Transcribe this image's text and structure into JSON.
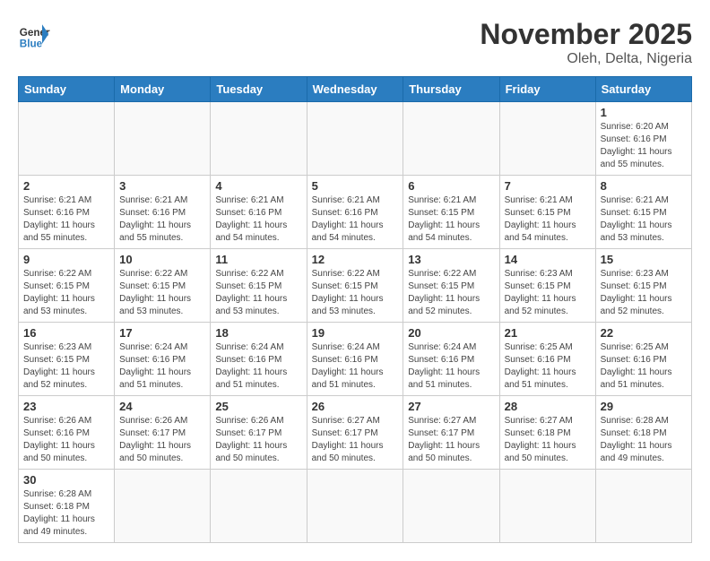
{
  "header": {
    "logo_general": "General",
    "logo_blue": "Blue",
    "month_year": "November 2025",
    "location": "Oleh, Delta, Nigeria"
  },
  "weekdays": [
    "Sunday",
    "Monday",
    "Tuesday",
    "Wednesday",
    "Thursday",
    "Friday",
    "Saturday"
  ],
  "weeks": [
    [
      {
        "day": "",
        "info": ""
      },
      {
        "day": "",
        "info": ""
      },
      {
        "day": "",
        "info": ""
      },
      {
        "day": "",
        "info": ""
      },
      {
        "day": "",
        "info": ""
      },
      {
        "day": "",
        "info": ""
      },
      {
        "day": "1",
        "info": "Sunrise: 6:20 AM\nSunset: 6:16 PM\nDaylight: 11 hours\nand 55 minutes."
      }
    ],
    [
      {
        "day": "2",
        "info": "Sunrise: 6:21 AM\nSunset: 6:16 PM\nDaylight: 11 hours\nand 55 minutes."
      },
      {
        "day": "3",
        "info": "Sunrise: 6:21 AM\nSunset: 6:16 PM\nDaylight: 11 hours\nand 55 minutes."
      },
      {
        "day": "4",
        "info": "Sunrise: 6:21 AM\nSunset: 6:16 PM\nDaylight: 11 hours\nand 54 minutes."
      },
      {
        "day": "5",
        "info": "Sunrise: 6:21 AM\nSunset: 6:16 PM\nDaylight: 11 hours\nand 54 minutes."
      },
      {
        "day": "6",
        "info": "Sunrise: 6:21 AM\nSunset: 6:15 PM\nDaylight: 11 hours\nand 54 minutes."
      },
      {
        "day": "7",
        "info": "Sunrise: 6:21 AM\nSunset: 6:15 PM\nDaylight: 11 hours\nand 54 minutes."
      },
      {
        "day": "8",
        "info": "Sunrise: 6:21 AM\nSunset: 6:15 PM\nDaylight: 11 hours\nand 53 minutes."
      }
    ],
    [
      {
        "day": "9",
        "info": "Sunrise: 6:22 AM\nSunset: 6:15 PM\nDaylight: 11 hours\nand 53 minutes."
      },
      {
        "day": "10",
        "info": "Sunrise: 6:22 AM\nSunset: 6:15 PM\nDaylight: 11 hours\nand 53 minutes."
      },
      {
        "day": "11",
        "info": "Sunrise: 6:22 AM\nSunset: 6:15 PM\nDaylight: 11 hours\nand 53 minutes."
      },
      {
        "day": "12",
        "info": "Sunrise: 6:22 AM\nSunset: 6:15 PM\nDaylight: 11 hours\nand 53 minutes."
      },
      {
        "day": "13",
        "info": "Sunrise: 6:22 AM\nSunset: 6:15 PM\nDaylight: 11 hours\nand 52 minutes."
      },
      {
        "day": "14",
        "info": "Sunrise: 6:23 AM\nSunset: 6:15 PM\nDaylight: 11 hours\nand 52 minutes."
      },
      {
        "day": "15",
        "info": "Sunrise: 6:23 AM\nSunset: 6:15 PM\nDaylight: 11 hours\nand 52 minutes."
      }
    ],
    [
      {
        "day": "16",
        "info": "Sunrise: 6:23 AM\nSunset: 6:15 PM\nDaylight: 11 hours\nand 52 minutes."
      },
      {
        "day": "17",
        "info": "Sunrise: 6:24 AM\nSunset: 6:16 PM\nDaylight: 11 hours\nand 51 minutes."
      },
      {
        "day": "18",
        "info": "Sunrise: 6:24 AM\nSunset: 6:16 PM\nDaylight: 11 hours\nand 51 minutes."
      },
      {
        "day": "19",
        "info": "Sunrise: 6:24 AM\nSunset: 6:16 PM\nDaylight: 11 hours\nand 51 minutes."
      },
      {
        "day": "20",
        "info": "Sunrise: 6:24 AM\nSunset: 6:16 PM\nDaylight: 11 hours\nand 51 minutes."
      },
      {
        "day": "21",
        "info": "Sunrise: 6:25 AM\nSunset: 6:16 PM\nDaylight: 11 hours\nand 51 minutes."
      },
      {
        "day": "22",
        "info": "Sunrise: 6:25 AM\nSunset: 6:16 PM\nDaylight: 11 hours\nand 51 minutes."
      }
    ],
    [
      {
        "day": "23",
        "info": "Sunrise: 6:26 AM\nSunset: 6:16 PM\nDaylight: 11 hours\nand 50 minutes."
      },
      {
        "day": "24",
        "info": "Sunrise: 6:26 AM\nSunset: 6:17 PM\nDaylight: 11 hours\nand 50 minutes."
      },
      {
        "day": "25",
        "info": "Sunrise: 6:26 AM\nSunset: 6:17 PM\nDaylight: 11 hours\nand 50 minutes."
      },
      {
        "day": "26",
        "info": "Sunrise: 6:27 AM\nSunset: 6:17 PM\nDaylight: 11 hours\nand 50 minutes."
      },
      {
        "day": "27",
        "info": "Sunrise: 6:27 AM\nSunset: 6:17 PM\nDaylight: 11 hours\nand 50 minutes."
      },
      {
        "day": "28",
        "info": "Sunrise: 6:27 AM\nSunset: 6:18 PM\nDaylight: 11 hours\nand 50 minutes."
      },
      {
        "day": "29",
        "info": "Sunrise: 6:28 AM\nSunset: 6:18 PM\nDaylight: 11 hours\nand 49 minutes."
      }
    ],
    [
      {
        "day": "30",
        "info": "Sunrise: 6:28 AM\nSunset: 6:18 PM\nDaylight: 11 hours\nand 49 minutes."
      },
      {
        "day": "",
        "info": ""
      },
      {
        "day": "",
        "info": ""
      },
      {
        "day": "",
        "info": ""
      },
      {
        "day": "",
        "info": ""
      },
      {
        "day": "",
        "info": ""
      },
      {
        "day": "",
        "info": ""
      }
    ]
  ]
}
